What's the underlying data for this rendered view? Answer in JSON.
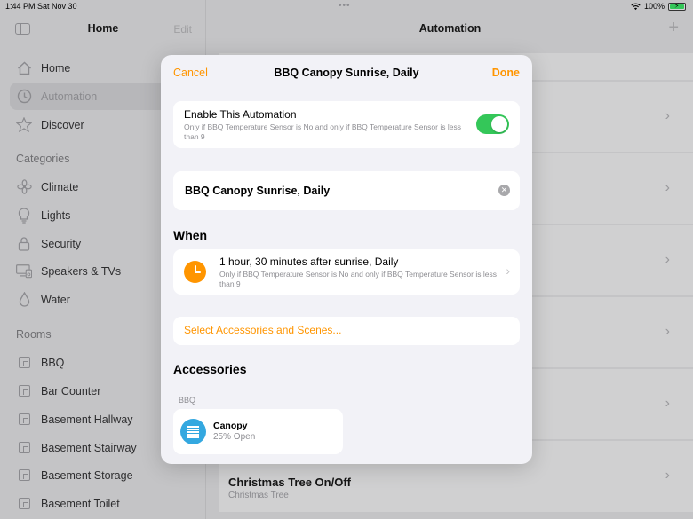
{
  "status_bar": {
    "time": "1:44 PM",
    "date": "Sat Nov 30",
    "battery": "100%"
  },
  "sidebar": {
    "title": "Home",
    "edit_label": "Edit",
    "nav": [
      {
        "label": "Home",
        "icon": "house-icon"
      },
      {
        "label": "Automation",
        "icon": "clock-icon",
        "active": true
      },
      {
        "label": "Discover",
        "icon": "star-icon"
      }
    ],
    "categories_label": "Categories",
    "categories": [
      {
        "label": "Climate",
        "icon": "fan-icon"
      },
      {
        "label": "Lights",
        "icon": "lightbulb-icon"
      },
      {
        "label": "Security",
        "icon": "lock-icon"
      },
      {
        "label": "Speakers & TVs",
        "icon": "tv-icon"
      },
      {
        "label": "Water",
        "icon": "drop-icon"
      }
    ],
    "rooms_label": "Rooms",
    "rooms": [
      "BBQ",
      "Bar Counter",
      "Basement Hallway",
      "Basement Stairway",
      "Basement Storage",
      "Basement Toilet"
    ]
  },
  "main": {
    "title": "Automation",
    "add_icon": "plus-icon",
    "bottom_item": {
      "title": "Christmas Tree On/Off",
      "subtitle": "Christmas Tree"
    }
  },
  "modal": {
    "cancel_label": "Cancel",
    "title": "BBQ Canopy Sunrise, Daily",
    "done_label": "Done",
    "enable": {
      "title": "Enable This Automation",
      "subtitle": "Only if BBQ Temperature Sensor is No and only if BBQ Temperature Sensor is less than 9",
      "on": true
    },
    "name_value": "BBQ Canopy Sunrise, Daily",
    "when_header": "When",
    "when": {
      "title": "1 hour, 30 minutes after sunrise, Daily",
      "subtitle": "Only if BBQ Temperature Sensor is No and only if BBQ Temperature Sensor is less than 9"
    },
    "select_link": "Select Accessories and Scenes...",
    "accessories_header": "Accessories",
    "room_label": "BBQ",
    "accessory": {
      "name": "Canopy",
      "status": "25% Open"
    }
  },
  "colors": {
    "accent": "#ff9500",
    "toggle_on": "#34c759",
    "accessory_icon": "#34a8e0"
  }
}
